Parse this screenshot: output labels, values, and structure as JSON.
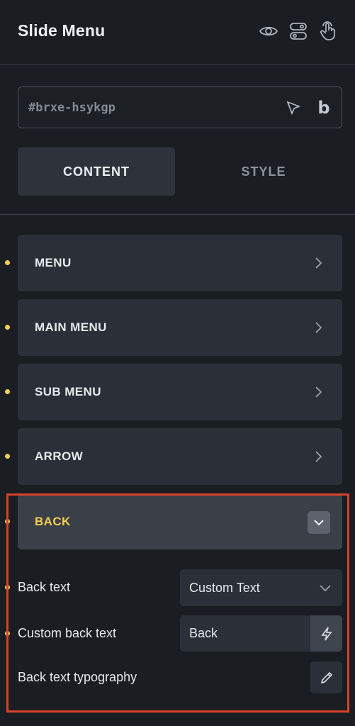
{
  "panel": {
    "title": "Slide Menu",
    "icons": [
      "eye-icon",
      "toggle-icon",
      "hand-pointer-icon"
    ]
  },
  "element_id": {
    "placeholder": "#brxe-hsykgp",
    "value": ""
  },
  "tabs": [
    {
      "label": "CONTENT",
      "active": true
    },
    {
      "label": "STYLE",
      "active": false
    }
  ],
  "sections": [
    {
      "label": "MENU"
    },
    {
      "label": "MAIN MENU"
    },
    {
      "label": "SUB MENU"
    },
    {
      "label": "ARROW"
    }
  ],
  "back_section": {
    "label": "BACK",
    "controls": {
      "back_text": {
        "label": "Back text",
        "value": "Custom Text"
      },
      "custom_back_text": {
        "label": "Custom back text",
        "value": "Back"
      },
      "typography": {
        "label": "Back text typography"
      }
    }
  },
  "colors": {
    "accent": "#f2cf4f",
    "highlight": "#d8412a",
    "background": "#1a1d22",
    "section": "#2b3038"
  }
}
